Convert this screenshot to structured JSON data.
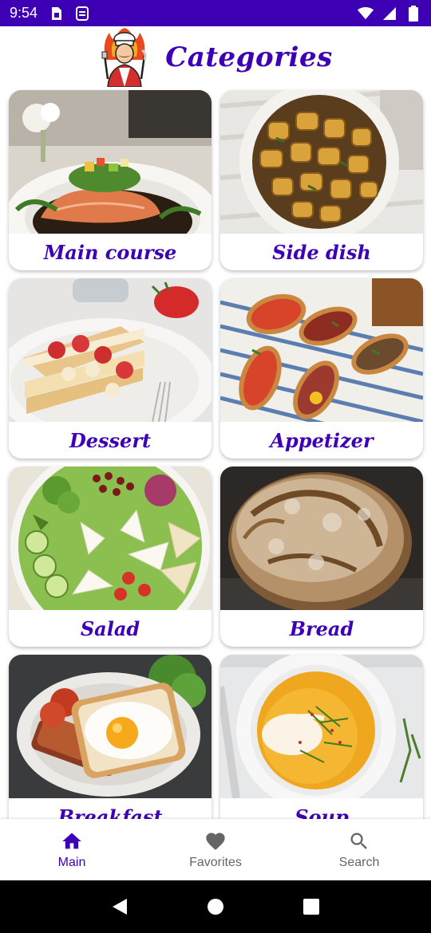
{
  "status_bar": {
    "time": "9:54",
    "left_icons": [
      "sim-card-icon",
      "storage-icon"
    ],
    "right_icons": [
      "wifi-icon",
      "signal-icon",
      "battery-icon"
    ],
    "background_color": "#3d00b5"
  },
  "header": {
    "logo": "chef-logo",
    "title": "Categories",
    "title_color": "#3d00b5"
  },
  "categories": [
    {
      "label": "Main course",
      "image": "salmon-plate"
    },
    {
      "label": "Side dish",
      "image": "roasted-potatoes"
    },
    {
      "label": "Dessert",
      "image": "strawberry-millefeuille"
    },
    {
      "label": "Appetizer",
      "image": "bruschetta"
    },
    {
      "label": "Salad",
      "image": "mixed-salad"
    },
    {
      "label": "Bread",
      "image": "sourdough-loaf"
    },
    {
      "label": "Breakfast",
      "image": "fried-egg-toast"
    },
    {
      "label": "Soup",
      "image": "pumpkin-soup"
    }
  ],
  "bottom_nav": {
    "items": [
      {
        "label": "Main",
        "icon": "home-icon",
        "active": true
      },
      {
        "label": "Favorites",
        "icon": "heart-icon",
        "active": false
      },
      {
        "label": "Search",
        "icon": "search-icon",
        "active": false
      }
    ],
    "active_color": "#3d00b5"
  },
  "system_nav": {
    "buttons": [
      "back-icon",
      "home-circle-icon",
      "recents-icon"
    ]
  }
}
